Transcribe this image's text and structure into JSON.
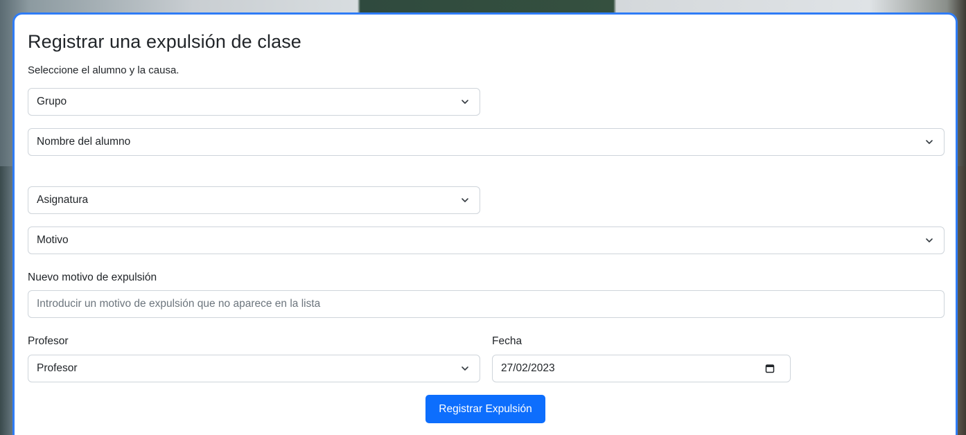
{
  "form": {
    "title": "Registrar una expulsión de clase",
    "subtitle": "Seleccione el alumno y la causa.",
    "grupo_select": "Grupo",
    "alumno_select": "Nombre del alumno",
    "asignatura_select": "Asignatura",
    "motivo_select": "Motivo",
    "nuevo_motivo_label": "Nuevo motivo de expulsión",
    "nuevo_motivo_placeholder": "Introducir un motivo de expulsión que no aparece en la lista",
    "profesor_label": "Profesor",
    "profesor_select": "Profesor",
    "fecha_label": "Fecha",
    "fecha_value": "27/02/2023",
    "submit_label": "Registrar Expulsión"
  },
  "colors": {
    "accent": "#0d6efd",
    "card_border": "#2f7cf6",
    "field_border": "#ced4da",
    "placeholder": "#6c757d"
  },
  "icons": {
    "select": "chevron-down-icon",
    "date": "calendar-icon"
  }
}
